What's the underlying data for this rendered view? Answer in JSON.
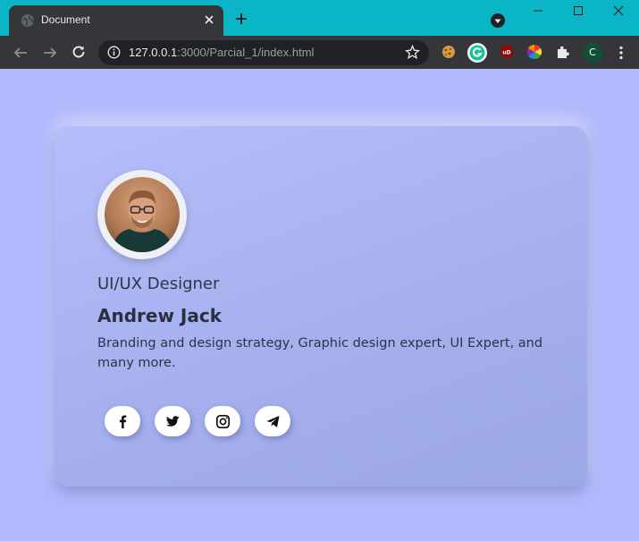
{
  "browser": {
    "tab_title": "Document",
    "url_host": "127.0.0.1",
    "url_rest": ":3000/Parcial_1/index.html",
    "profile_initial": "C",
    "colors": {
      "frame": "#0ab5c5",
      "toolbar": "#35363a",
      "omnibox": "#202124"
    }
  },
  "profile_card": {
    "role": "UI/UX Designer",
    "name": "Andrew Jack",
    "bio": "Branding and design strategy, Graphic design expert, UI Expert, and many more.",
    "socials": [
      "facebook-icon",
      "twitter-icon",
      "instagram-icon",
      "telegram-icon"
    ]
  },
  "colors": {
    "page_bg": "#b0b9fb",
    "card_bg": "#a6b0ee"
  }
}
